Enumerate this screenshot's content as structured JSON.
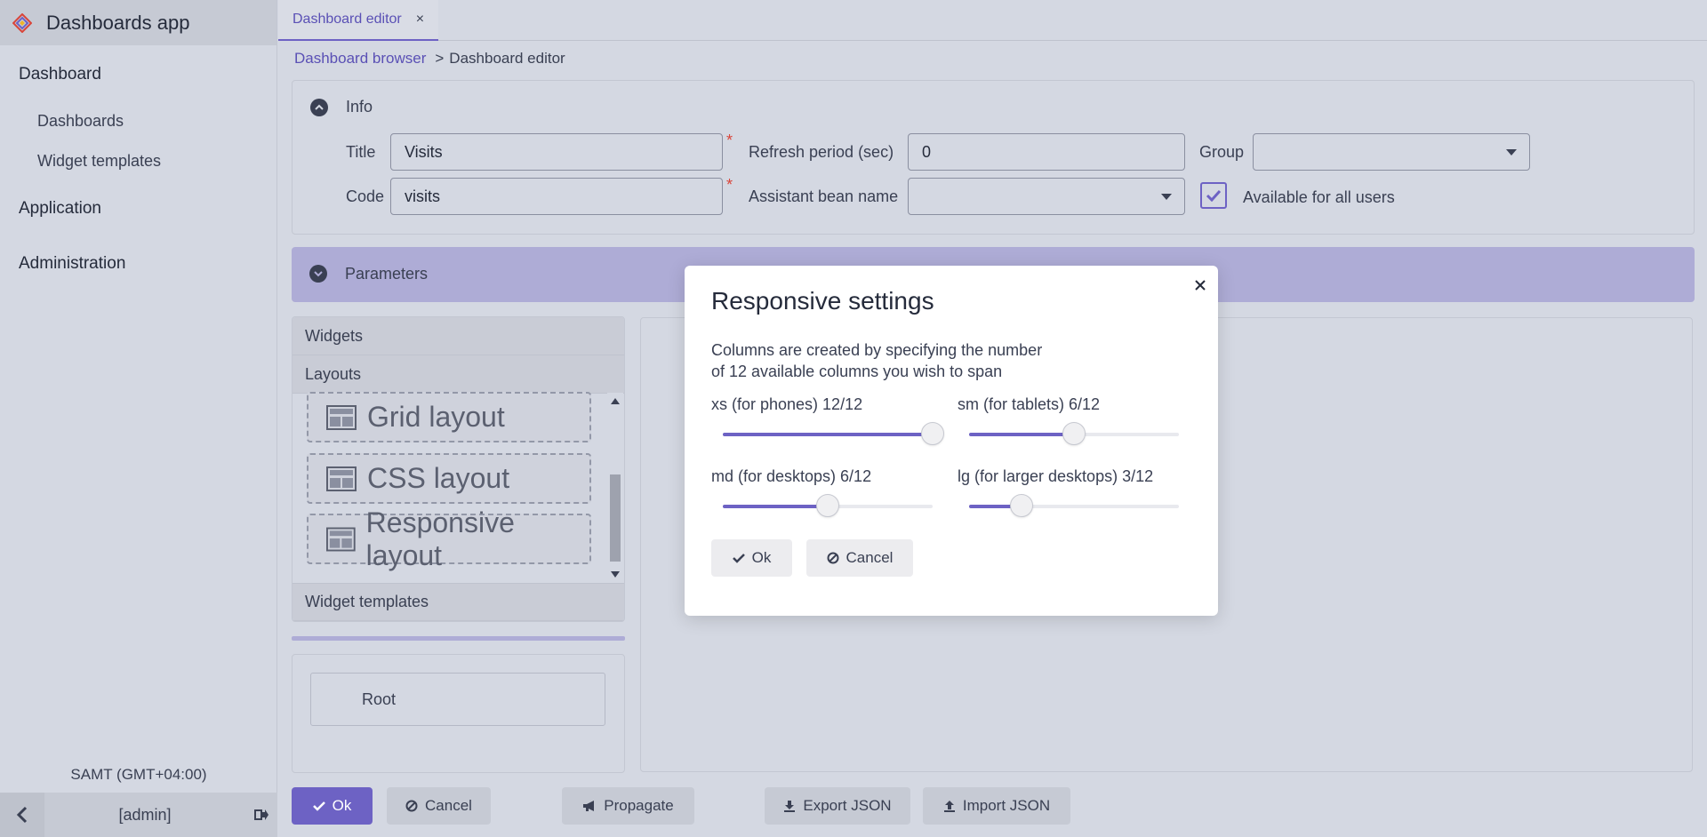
{
  "app": {
    "title": "Dashboards app"
  },
  "sidebar": {
    "items": [
      {
        "label": "Dashboard"
      },
      {
        "label": "Dashboards"
      },
      {
        "label": "Widget templates"
      },
      {
        "label": "Application"
      },
      {
        "label": "Administration"
      }
    ],
    "timezone": "SAMT (GMT+04:00)",
    "user": "[admin]"
  },
  "tab": {
    "label": "Dashboard editor",
    "close": "×"
  },
  "breadcrumb": {
    "parent": "Dashboard browser",
    "separator": ">",
    "current": "Dashboard editor"
  },
  "info": {
    "title": "Info",
    "title_label": "Title",
    "title_value": "Visits",
    "code_label": "Code",
    "code_value": "visits",
    "refresh_label": "Refresh period (sec)",
    "refresh_value": "0",
    "bean_label": "Assistant bean name",
    "bean_value": "",
    "group_label": "Group",
    "group_value": "",
    "available_label": "Available for all users",
    "available_checked": true,
    "required_mark": "*"
  },
  "parameters": {
    "title": "Parameters"
  },
  "palette": {
    "widgets": "Widgets",
    "layouts": "Layouts",
    "layout_items": [
      {
        "label": "Grid layout"
      },
      {
        "label": "CSS layout"
      },
      {
        "label": "Responsive layout"
      }
    ],
    "widget_templates": "Widget templates"
  },
  "tree": {
    "root": "Root"
  },
  "actions": {
    "ok": "Ok",
    "cancel": "Cancel",
    "propagate": "Propagate",
    "export": "Export JSON",
    "import": "Import JSON"
  },
  "modal": {
    "title": "Responsive settings",
    "description_line1": "Columns are created by specifying the number",
    "description_line2": "of 12 available columns you wish to span",
    "sliders": [
      {
        "label": "xs (for phones) 12/12",
        "value": 12,
        "max": 12
      },
      {
        "label": "sm (for tablets) 6/12",
        "value": 6,
        "max": 12
      },
      {
        "label": "md (for desktops) 6/12",
        "value": 6,
        "max": 12
      },
      {
        "label": "lg (for larger desktops) 3/12",
        "value": 3,
        "max": 12
      }
    ],
    "ok": "Ok",
    "cancel": "Cancel"
  },
  "colors": {
    "accent": "#6d62c4",
    "background": "#d4d8e2",
    "parameters_bar": "#aeacd6",
    "required": "#d9453a"
  }
}
